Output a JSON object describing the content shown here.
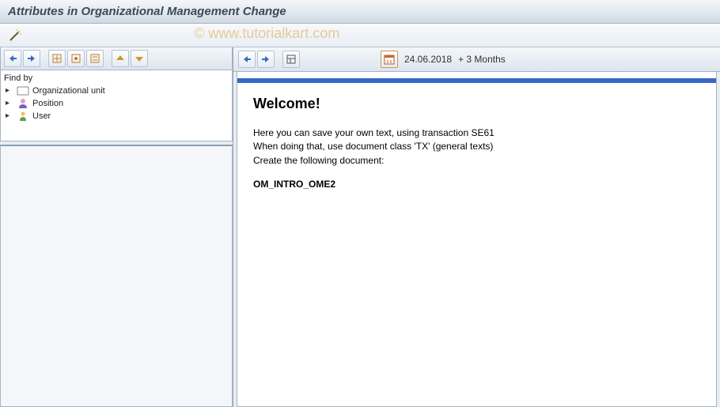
{
  "title": "Attributes in Organizational Management Change",
  "watermark": "© www.tutorialkart.com",
  "left": {
    "find_by_label": "Find by",
    "tree": [
      {
        "label": "Organizational unit",
        "icon": "org"
      },
      {
        "label": "Position",
        "icon": "person"
      },
      {
        "label": "User",
        "icon": "user"
      }
    ]
  },
  "right": {
    "date": "24.06.2018",
    "period": "+ 3 Months"
  },
  "content": {
    "heading": "Welcome!",
    "line1": "Here you can save your own text, using transaction SE61",
    "line2": "When doing that, use document class 'TX' (general texts)",
    "line3": "Create the following document:",
    "doc": "OM_INTRO_OME2"
  }
}
